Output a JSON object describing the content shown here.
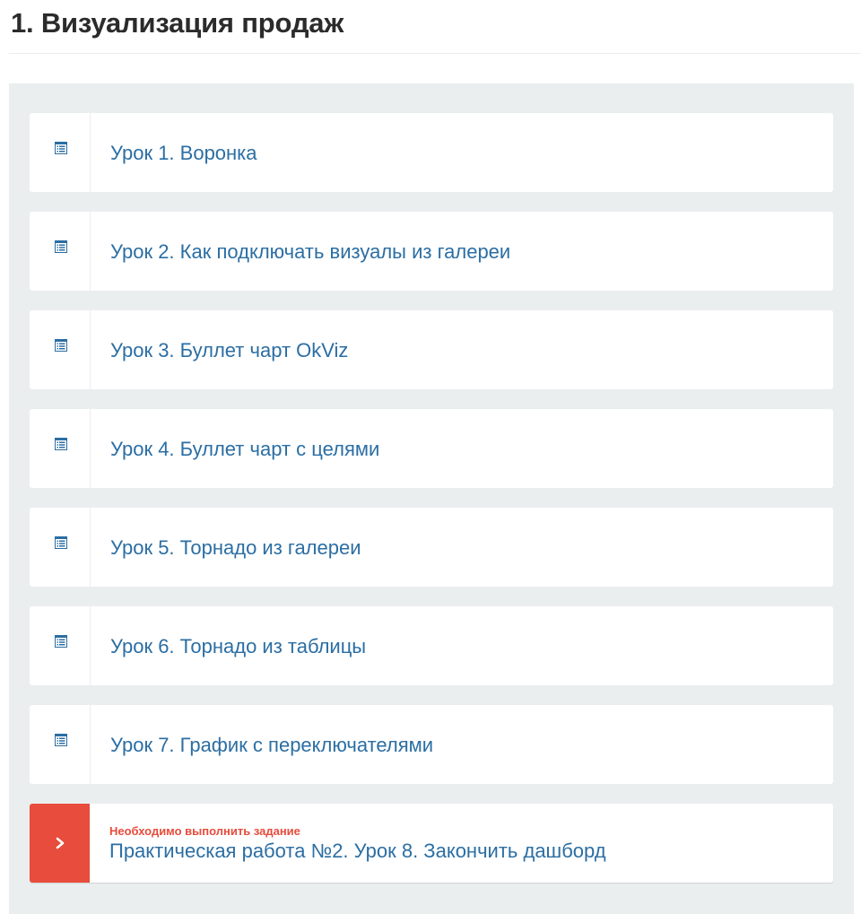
{
  "section": {
    "title": "1. Визуализация продаж"
  },
  "colors": {
    "accent": "#2b6ea3",
    "task_red": "#e74c3c",
    "panel_bg": "#ebeeef"
  },
  "lessons": [
    {
      "title": "Урок 1. Воронка",
      "icon": "document-list-icon"
    },
    {
      "title": "Урок 2. Как подключать визуалы из галереи",
      "icon": "document-list-icon"
    },
    {
      "title": "Урок 3. Буллет чарт OkViz",
      "icon": "document-list-icon"
    },
    {
      "title": "Урок 4. Буллет чарт с целями",
      "icon": "document-list-icon"
    },
    {
      "title": "Урок 5. Торнадо из галереи",
      "icon": "document-list-icon"
    },
    {
      "title": "Урок 6. Торнадо из таблицы",
      "icon": "document-list-icon"
    },
    {
      "title": "Урок 7. График с переключателями",
      "icon": "document-list-icon"
    }
  ],
  "task": {
    "note": "Необходимо выполнить задание",
    "title": "Практическая работа №2. Урок 8. Закончить дашборд",
    "icon": "chevron-right-icon"
  }
}
